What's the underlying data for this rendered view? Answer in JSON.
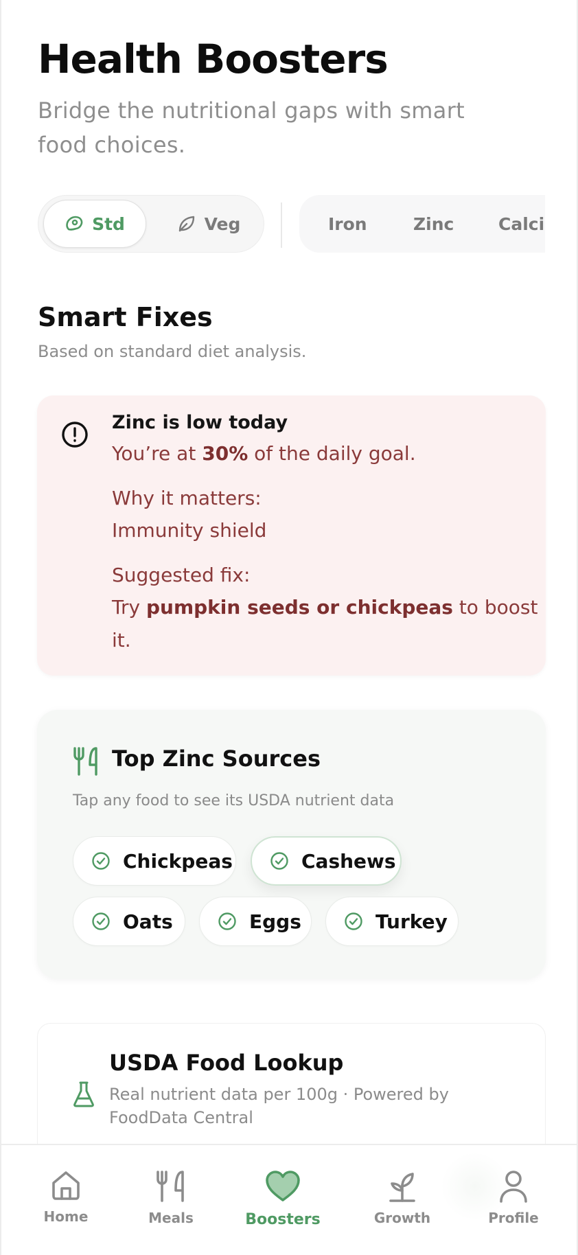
{
  "header": {
    "title": "Health Boosters",
    "subtitle": "Bridge the nutritional gaps with smart food choices."
  },
  "diet_toggle": {
    "options": [
      {
        "label": "Std",
        "icon": "meat-icon",
        "selected": true
      },
      {
        "label": "Veg",
        "icon": "leaf-icon",
        "selected": false
      }
    ]
  },
  "nutrient_filters": {
    "items": [
      "Iron",
      "Zinc",
      "Calciu"
    ]
  },
  "smart_fixes": {
    "title": "Smart Fixes",
    "subtitle": "Based on standard diet analysis."
  },
  "alert": {
    "icon": "alert-circle-icon",
    "title": "Zinc is low today",
    "progress_prefix": "You’re at ",
    "progress_value": "30%",
    "progress_suffix": " of the daily goal.",
    "why_label": "Why it matters:",
    "why_value": "Immunity shield",
    "fix_label": "Suggested fix:",
    "fix_prefix": "Try ",
    "fix_foods": "pumpkin seeds or chickpeas",
    "fix_suffix": " to boost",
    "fix_end": "it."
  },
  "sources": {
    "icon": "utensils-icon",
    "title": "Top Zinc Sources",
    "subtitle": "Tap any food to see its USDA nutrient data",
    "foods": [
      {
        "label": "Chickpeas",
        "selected": false
      },
      {
        "label": "Cashews",
        "selected": true
      },
      {
        "label": "Oats",
        "selected": false
      },
      {
        "label": "Eggs",
        "selected": false
      },
      {
        "label": "Turkey",
        "selected": false
      }
    ]
  },
  "usda": {
    "icon": "flask-icon",
    "title": "USDA Food Lookup",
    "subtitle": "Real nutrient data per 100g · Powered by FoodData Central"
  },
  "bottom_nav": {
    "items": [
      {
        "label": "Home",
        "icon": "home-icon"
      },
      {
        "label": "Meals",
        "icon": "utensils-icon"
      },
      {
        "label": "Boosters",
        "icon": "heart-icon",
        "active": true
      },
      {
        "label": "Growth",
        "icon": "sprout-icon"
      },
      {
        "label": "Profile",
        "icon": "user-icon"
      }
    ]
  },
  "colors": {
    "accent_green": "#4f9a63",
    "alert_bg": "#fcf1f1",
    "alert_text": "#8a3a3a",
    "muted_text": "#8c8c8c"
  }
}
